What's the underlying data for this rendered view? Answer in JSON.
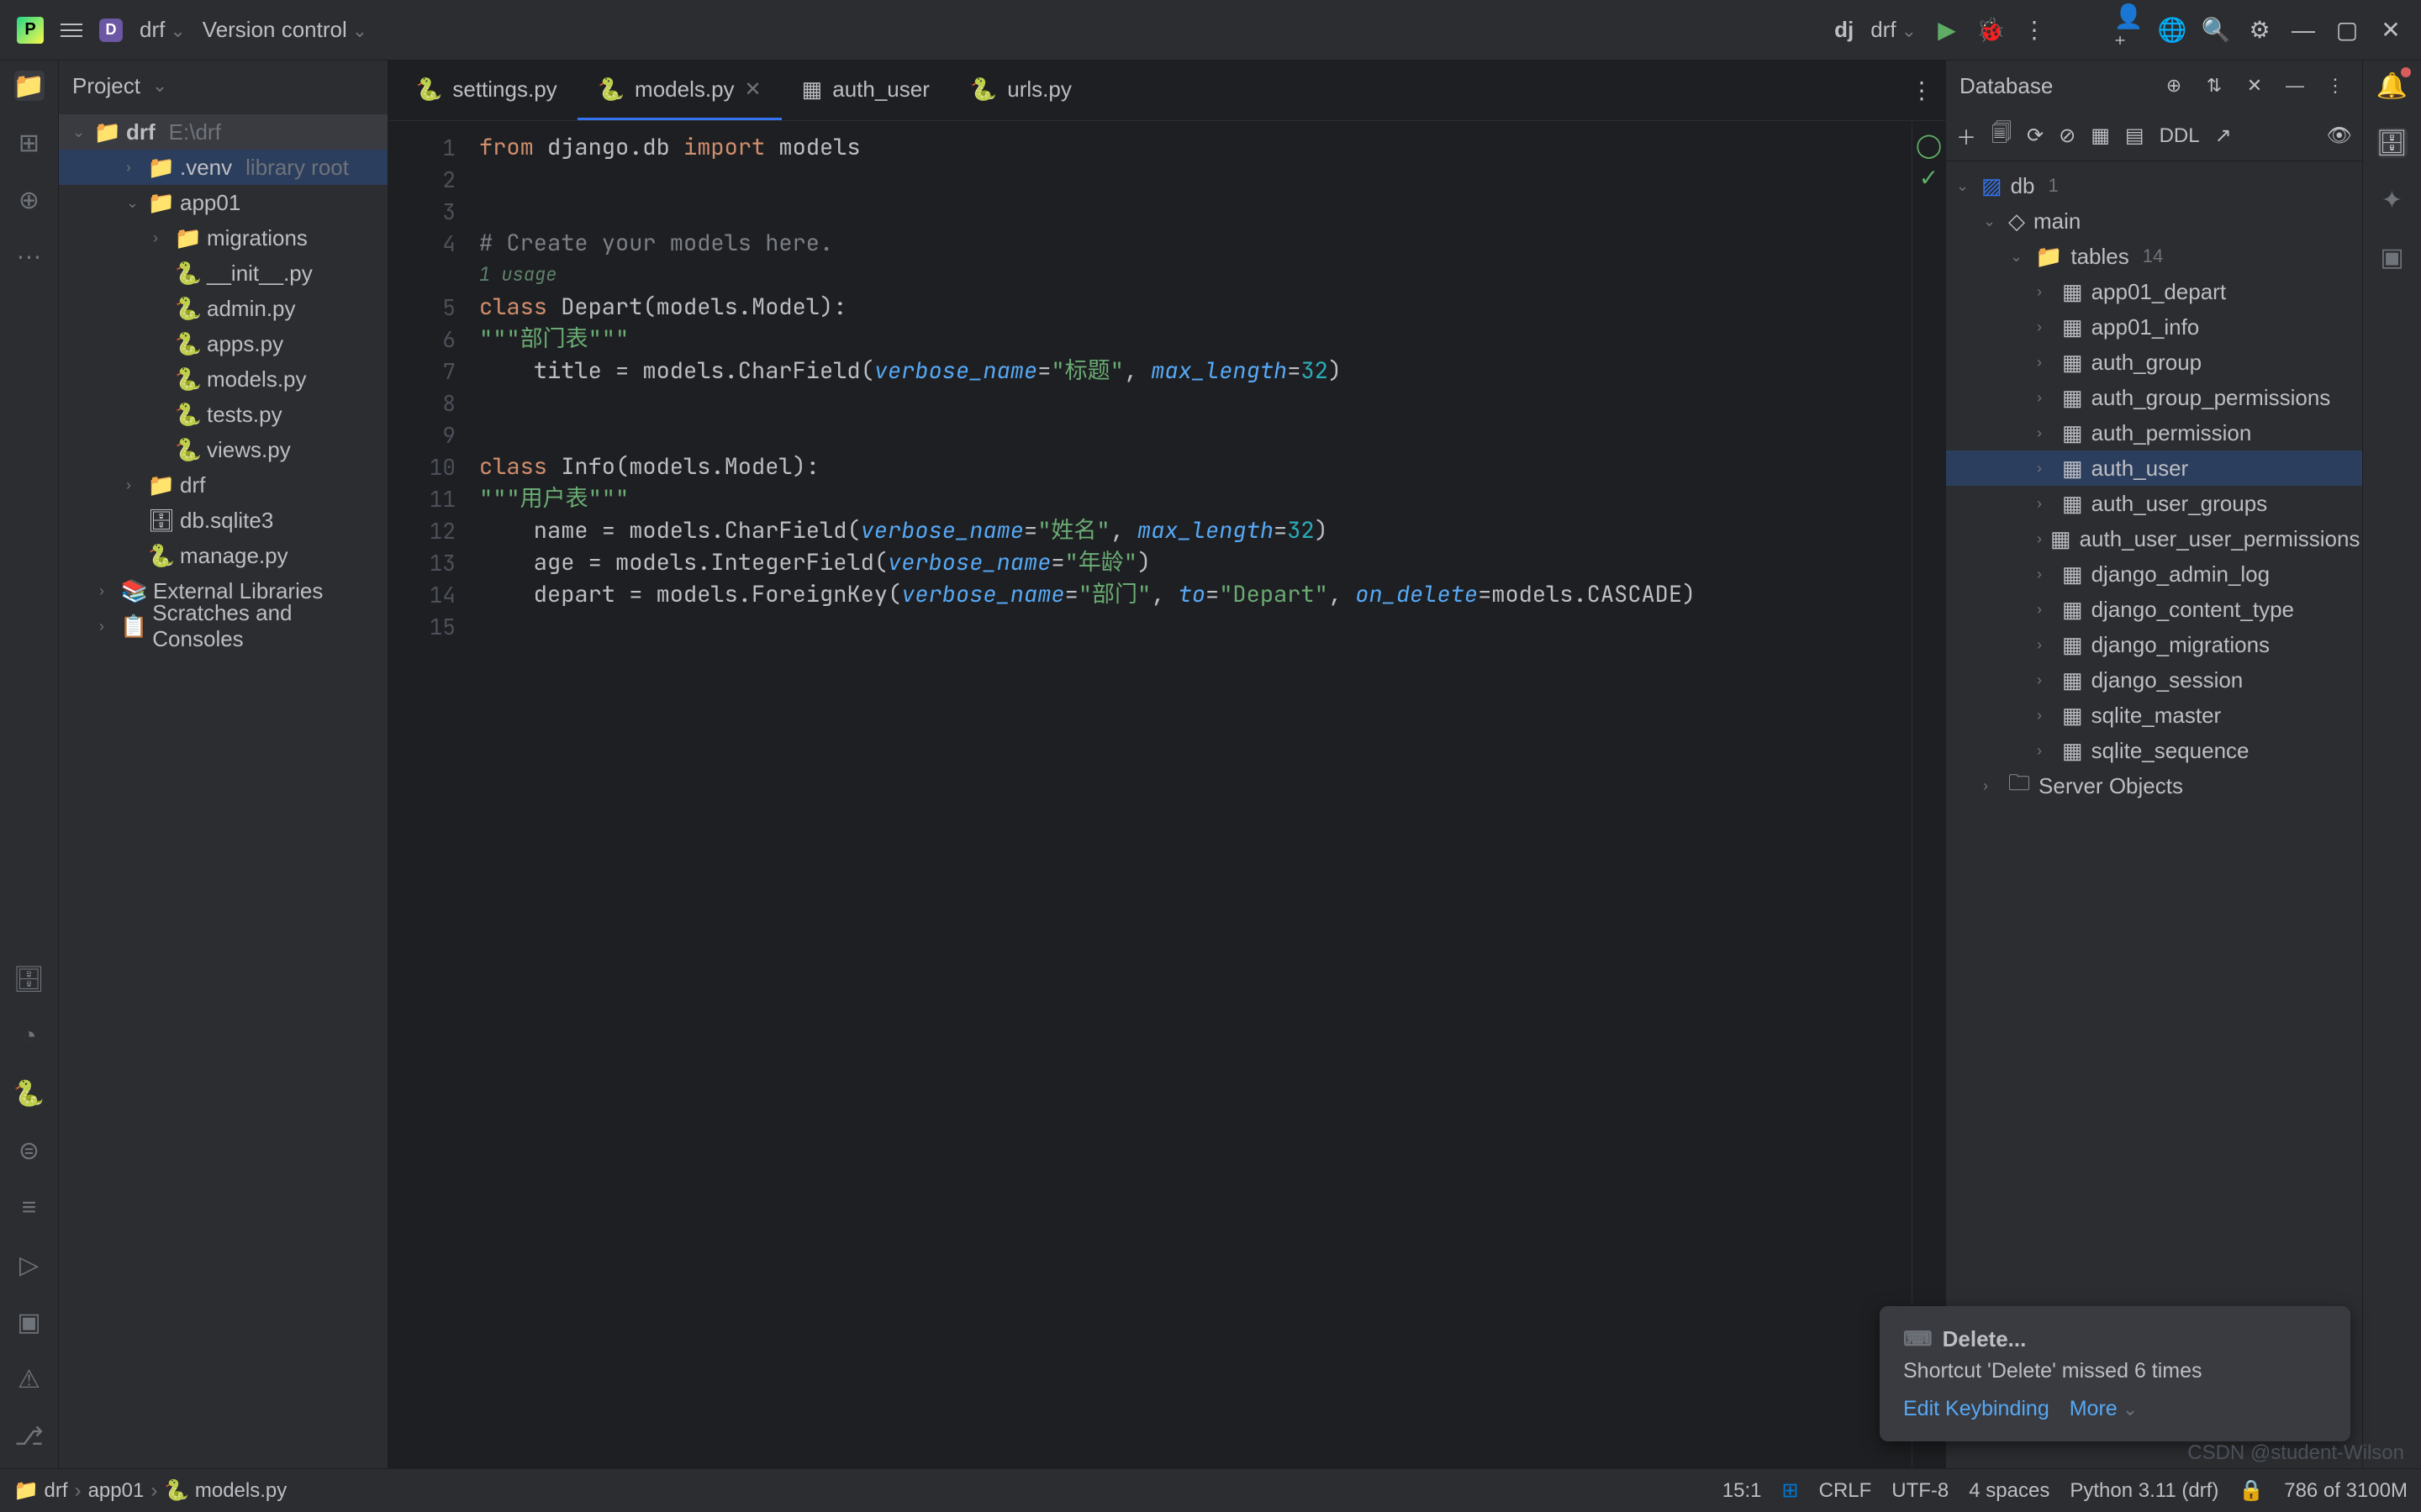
{
  "topbar": {
    "project_letter": "D",
    "project_name": "drf",
    "vcs_label": "Version control",
    "framework": "dj",
    "run_config": "drf"
  },
  "project_panel": {
    "title": "Project",
    "root": {
      "name": "drf",
      "path": "E:\\drf"
    },
    "items": [
      {
        "name": ".venv",
        "annotation": "library root",
        "icon": "folder",
        "depth": 1,
        "chevron": ">"
      },
      {
        "name": "app01",
        "icon": "folder",
        "depth": 1,
        "chevron": "v"
      },
      {
        "name": "migrations",
        "icon": "folder",
        "depth": 2,
        "chevron": ">"
      },
      {
        "name": "__init__.py",
        "icon": "python",
        "depth": 2
      },
      {
        "name": "admin.py",
        "icon": "python",
        "depth": 2
      },
      {
        "name": "apps.py",
        "icon": "python",
        "depth": 2
      },
      {
        "name": "models.py",
        "icon": "python",
        "depth": 2
      },
      {
        "name": "tests.py",
        "icon": "python",
        "depth": 2
      },
      {
        "name": "views.py",
        "icon": "python",
        "depth": 2
      },
      {
        "name": "drf",
        "icon": "folder",
        "depth": 1,
        "chevron": ">"
      },
      {
        "name": "db.sqlite3",
        "icon": "db",
        "depth": 1
      },
      {
        "name": "manage.py",
        "icon": "python",
        "depth": 1
      },
      {
        "name": "External Libraries",
        "icon": "lib",
        "depth": 0,
        "chevron": ">"
      },
      {
        "name": "Scratches and Consoles",
        "icon": "scratch",
        "depth": 0,
        "chevron": ">"
      }
    ]
  },
  "tabs": [
    {
      "label": "settings.py",
      "icon": "python"
    },
    {
      "label": "models.py",
      "icon": "python",
      "active": true,
      "closeable": true
    },
    {
      "label": "auth_user",
      "icon": "table"
    },
    {
      "label": "urls.py",
      "icon": "python"
    }
  ],
  "code": {
    "lines": [
      {
        "n": 1,
        "tokens": [
          [
            "kw",
            "from"
          ],
          [
            "",
            " django.db "
          ],
          [
            "kw",
            "import"
          ],
          [
            "",
            " models"
          ]
        ]
      },
      {
        "n": 2,
        "tokens": []
      },
      {
        "n": 3,
        "tokens": []
      },
      {
        "n": 4,
        "tokens": [
          [
            "comment",
            "# Create your models here."
          ]
        ]
      },
      {
        "usage": "1 usage"
      },
      {
        "n": 5,
        "tokens": [
          [
            "kw",
            "class"
          ],
          [
            "",
            " Depart(models.Model):"
          ]
        ]
      },
      {
        "n": 6,
        "tokens": [
          [
            "",
            "    "
          ],
          [
            "str",
            "\"\"\"部门表\"\"\""
          ]
        ]
      },
      {
        "n": 7,
        "tokens": [
          [
            "",
            "    title = models.CharField("
          ],
          [
            "param",
            "verbose_name"
          ],
          [
            "",
            "="
          ],
          [
            "str",
            "\"标题\""
          ],
          [
            "",
            ", "
          ],
          [
            "param",
            "max_length"
          ],
          [
            "",
            "="
          ],
          [
            "num",
            "32"
          ],
          [
            "",
            ")"
          ]
        ]
      },
      {
        "n": 8,
        "tokens": []
      },
      {
        "n": 9,
        "tokens": []
      },
      {
        "n": 10,
        "tokens": [
          [
            "kw",
            "class"
          ],
          [
            "",
            " Info(models.Model):"
          ]
        ]
      },
      {
        "n": 11,
        "tokens": [
          [
            "",
            "    "
          ],
          [
            "str",
            "\"\"\"用户表\"\"\""
          ]
        ]
      },
      {
        "n": 12,
        "tokens": [
          [
            "",
            "    name = models.CharField("
          ],
          [
            "param",
            "verbose_name"
          ],
          [
            "",
            "="
          ],
          [
            "str",
            "\"姓名\""
          ],
          [
            "",
            ", "
          ],
          [
            "param",
            "max_length"
          ],
          [
            "",
            "="
          ],
          [
            "num",
            "32"
          ],
          [
            "",
            ")"
          ]
        ]
      },
      {
        "n": 13,
        "tokens": [
          [
            "",
            "    age = models.IntegerField("
          ],
          [
            "param",
            "verbose_name"
          ],
          [
            "",
            "="
          ],
          [
            "str",
            "\"年龄\""
          ],
          [
            "",
            ")"
          ]
        ]
      },
      {
        "n": 14,
        "tokens": [
          [
            "",
            "    depart = models.ForeignKey("
          ],
          [
            "param",
            "verbose_name"
          ],
          [
            "",
            "="
          ],
          [
            "str",
            "\"部门\""
          ],
          [
            "",
            ", "
          ],
          [
            "param",
            "to"
          ],
          [
            "",
            "="
          ],
          [
            "str",
            "\"Depart\""
          ],
          [
            "",
            ", "
          ],
          [
            "param",
            "on_delete"
          ],
          [
            "",
            "=models.CASCADE)"
          ]
        ]
      },
      {
        "n": 15,
        "tokens": [],
        "current": true
      }
    ]
  },
  "database_panel": {
    "title": "Database",
    "ddl_label": "DDL",
    "root": {
      "name": "db",
      "count": "1"
    },
    "schema": "main",
    "tables_label": "tables",
    "tables_count": "14",
    "tables": [
      "app01_depart",
      "app01_info",
      "auth_group",
      "auth_group_permissions",
      "auth_permission",
      "auth_user",
      "auth_user_groups",
      "auth_user_user_permissions",
      "django_admin_log",
      "django_content_type",
      "django_migrations",
      "django_session",
      "sqlite_master",
      "sqlite_sequence"
    ],
    "selected_table": "auth_user",
    "server_objects": "Server Objects"
  },
  "notification": {
    "title": "Delete...",
    "body": "Shortcut 'Delete' missed 6 times",
    "action_edit": "Edit Keybinding",
    "action_more": "More"
  },
  "statusbar": {
    "breadcrumb": [
      "drf",
      "app01",
      "models.py"
    ],
    "cursor": "15:1",
    "line_sep": "CRLF",
    "encoding": "UTF-8",
    "indent": "4 spaces",
    "interpreter": "Python 3.11 (drf)",
    "memory": "786 of 3100M"
  },
  "watermark": "CSDN @student-Wilson"
}
